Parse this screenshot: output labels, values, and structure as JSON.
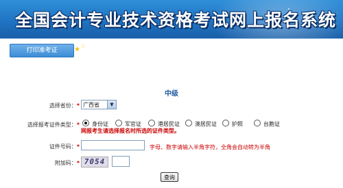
{
  "banner": {
    "title": "全国会计专业技术资格考试网上报名系统"
  },
  "tabs": {
    "print_ticket": "打印准考证"
  },
  "form": {
    "level": "中级",
    "province": {
      "label": "选择省份：",
      "required_mark": "*",
      "value": "广西省"
    },
    "cert_type": {
      "label": "选择报考证件类型：",
      "required_mark": "*",
      "options": [
        "身份证",
        "军官证",
        "港居民证",
        "澳居民证",
        "护照",
        "台胞证"
      ],
      "selected_index": 0,
      "warning": "网报考生请选择报名时所选的证件类型。"
    },
    "cert_number": {
      "label": "证件号码：",
      "required_mark": "*",
      "value": "",
      "hint": "字母、数字请输入半角字符，全角会自动转为半角"
    },
    "captcha": {
      "label": "附加码：",
      "required_mark": "*",
      "image_text": "7054",
      "value": ""
    },
    "submit_label": "查询"
  },
  "colors": {
    "banner": "#1f74c3",
    "accent_red": "#cc0000",
    "title_blue": "#1d5aa0"
  }
}
